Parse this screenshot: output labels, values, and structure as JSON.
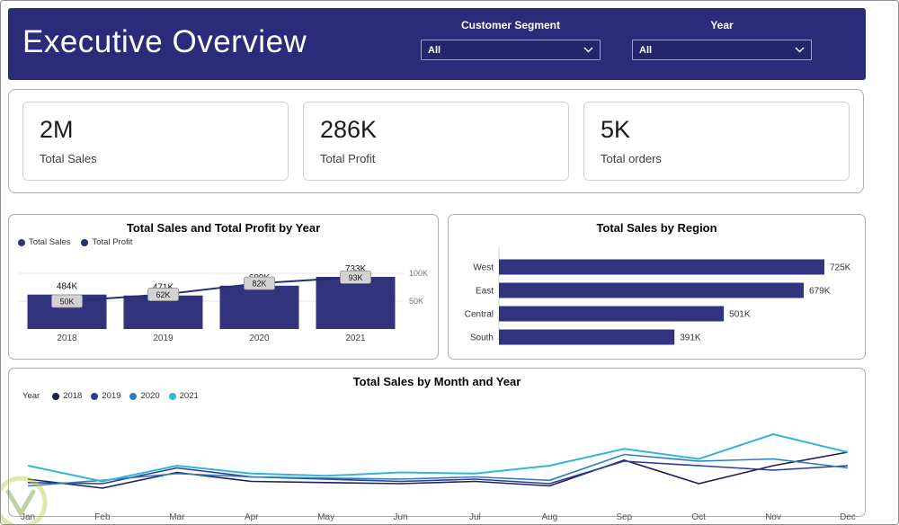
{
  "header": {
    "title": "Executive Overview",
    "filters": [
      {
        "label": "Customer Segment",
        "value": "All"
      },
      {
        "label": "Year",
        "value": "All"
      }
    ]
  },
  "kpis": [
    {
      "value": "2M",
      "label": "Total Sales"
    },
    {
      "value": "286K",
      "label": "Total Profit"
    },
    {
      "value": "5K",
      "label": "Total orders"
    }
  ],
  "colors": {
    "header_bg": "#2a2c79",
    "bar": "#32337d",
    "profit_line": "#24306b",
    "label_box_bg": "#d2d2d2",
    "label_box_border": "#8f8f8f",
    "grid": "#e4e4e4",
    "axis_text": "#757575",
    "watermark_outer": "#b9cc3f",
    "watermark_inner": "#6f9a3d"
  },
  "chart_data": [
    {
      "type": "combo",
      "title": "Total Sales and Total Profit by Year",
      "categories": [
        "2018",
        "2019",
        "2020",
        "2021"
      ],
      "series": [
        {
          "name": "Total Sales",
          "type": "bar",
          "color": "#32337d",
          "values": [
            484000,
            471000,
            609000,
            733000
          ],
          "labels": [
            "484K",
            "471K",
            "609K",
            "733K"
          ]
        },
        {
          "name": "Total Profit",
          "type": "line",
          "color": "#24306b",
          "values": [
            50000,
            62000,
            82000,
            93000
          ],
          "labels": [
            "50K",
            "62K",
            "82K",
            "93K"
          ]
        }
      ],
      "y2_axis": {
        "range": [
          0,
          110000
        ],
        "ticks": [
          {
            "value": 100000,
            "label": "100K"
          },
          {
            "value": 50000,
            "label": "50K"
          }
        ]
      },
      "legend_position": "top-left"
    },
    {
      "type": "bar",
      "orientation": "horizontal",
      "title": "Total Sales by Region",
      "categories": [
        "West",
        "East",
        "Central",
        "South"
      ],
      "values": [
        725000,
        679000,
        501000,
        391000
      ],
      "labels": [
        "725K",
        "679K",
        "501K",
        "391K"
      ],
      "color": "#32337d"
    },
    {
      "type": "line",
      "title": "Total Sales by Month and Year",
      "legend_title": "Year",
      "categories": [
        "Jan",
        "Feb",
        "Mar",
        "Apr",
        "May",
        "Jun",
        "Jul",
        "Aug",
        "Sep",
        "Oct",
        "Nov",
        "Dec"
      ],
      "series": [
        {
          "name": "2018",
          "color": "#1c2158",
          "values": [
            28,
            20,
            34,
            26,
            25,
            24,
            26,
            22,
            45,
            24,
            40,
            52
          ]
        },
        {
          "name": "2019",
          "color": "#2b3d96",
          "values": [
            25,
            24,
            38,
            30,
            28,
            26,
            28,
            24,
            44,
            40,
            36,
            40
          ]
        },
        {
          "name": "2020",
          "color": "#2d7dbd",
          "values": [
            22,
            27,
            33,
            30,
            29,
            28,
            30,
            27,
            50,
            44,
            46,
            38
          ]
        },
        {
          "name": "2021",
          "color": "#33b5da",
          "values": [
            40,
            26,
            40,
            33,
            31,
            34,
            33,
            40,
            55,
            46,
            68,
            52
          ]
        }
      ]
    }
  ]
}
